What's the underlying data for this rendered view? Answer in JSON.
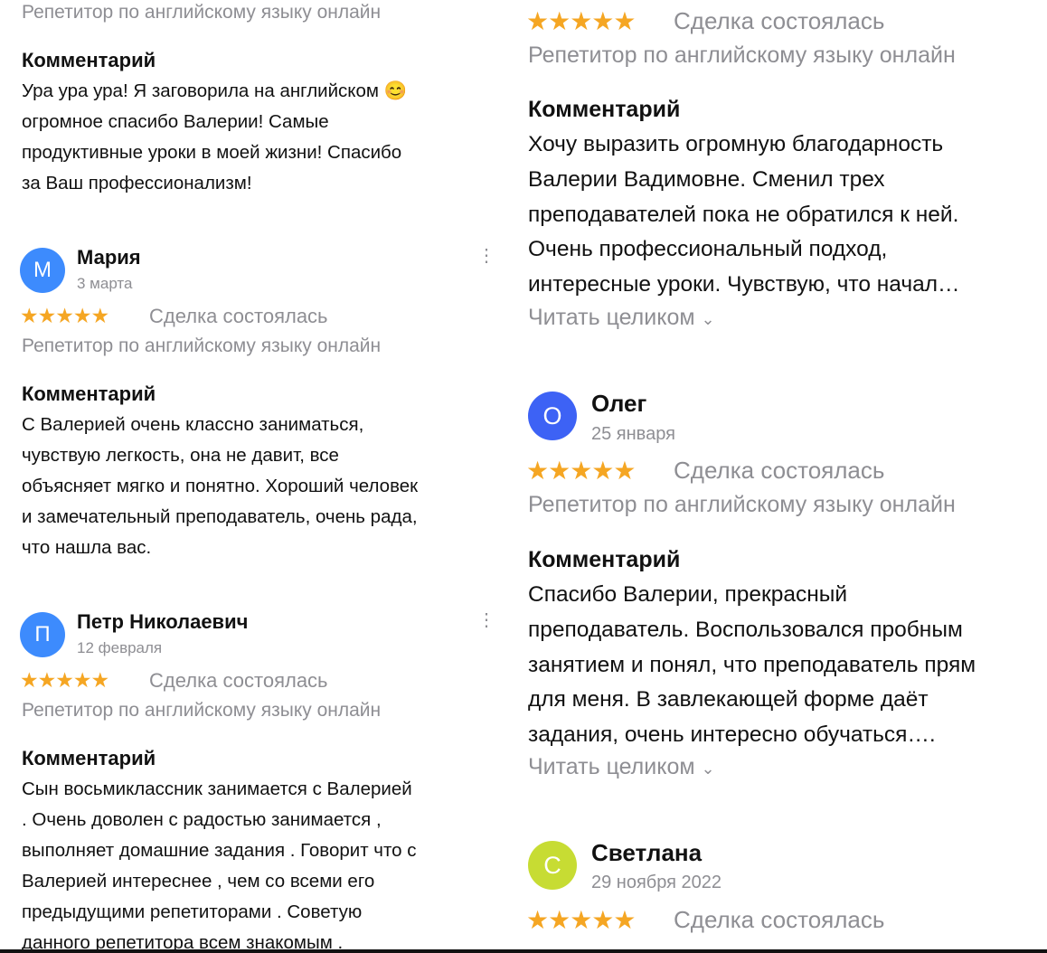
{
  "stars_glyph": "★★★★★",
  "kebab_glyph": "⋮",
  "chevron_glyph": "⌄",
  "colors": {
    "star": "#f5a623",
    "muted": "#8e8e93",
    "avatar_blue": "#3d8bfd",
    "avatar_yellow": "#c7dc33"
  },
  "left": {
    "review0": {
      "service": "Репетитор по английскому языку онлайн",
      "heading": "Комментарий",
      "lines": [
        "Ура ура ура! Я заговорила на английском 😊",
        "огромное спасибо Валерии! Самые",
        "продуктивные уроки в моей жизни! Спасибо",
        "за Ваш профессионализм!"
      ]
    },
    "review1": {
      "avatar": "М",
      "name": "Мария",
      "date": "3 марта",
      "deal": "Сделка состоялась",
      "service": "Репетитор по английскому языку онлайн",
      "heading": "Комментарий",
      "lines": [
        "С Валерией очень классно заниматься,",
        "чувствую легкость, она не давит, все",
        "объясняет мягко и понятно. Хороший человек",
        "и замечательный преподаватель, очень рада,",
        "что нашла вас."
      ]
    },
    "review2": {
      "avatar": "П",
      "name": "Петр Николаевич",
      "date": "12 февраля",
      "deal": "Сделка состоялась",
      "service": "Репетитор по английскому языку онлайн",
      "heading": "Комментарий",
      "lines": [
        "Сын восьмиклассник занимается с Валерией",
        ". Очень доволен с радостью занимается ,",
        "выполняет домашние задания . Говорит что с",
        "Валерией интереснее , чем со всеми его",
        "предыдущими репетиторами . Советую",
        "данного репетитора всем знакомым ."
      ]
    }
  },
  "right": {
    "review0": {
      "deal": "Сделка состоялась",
      "service": "Репетитор по английскому языку онлайн",
      "heading": "Комментарий",
      "lines": [
        "Хочу выразить огромную благодарность",
        "Валерии Вадимовне. Сменил трех",
        "преподавателей пока не обратился к ней.",
        "Очень профессиональный подход,",
        "интересные уроки. Чувствую, что начал…"
      ],
      "read_more": "Читать целиком"
    },
    "review1": {
      "avatar": "О",
      "name": "Олег",
      "date": "25 января",
      "deal": "Сделка состоялась",
      "service": "Репетитор по английскому языку онлайн",
      "heading": "Комментарий",
      "lines": [
        "Спасибо Валерии, прекрасный",
        "преподаватель. Воспользовался пробным",
        "занятием и понял, что преподаватель прям",
        "для меня. В завлекающей форме даёт",
        "задания, очень интересно обучаться…."
      ],
      "read_more": "Читать целиком"
    },
    "review2": {
      "avatar": "С",
      "name": "Светлана",
      "date": "29 ноября 2022",
      "deal": "Сделка состоялась"
    }
  }
}
